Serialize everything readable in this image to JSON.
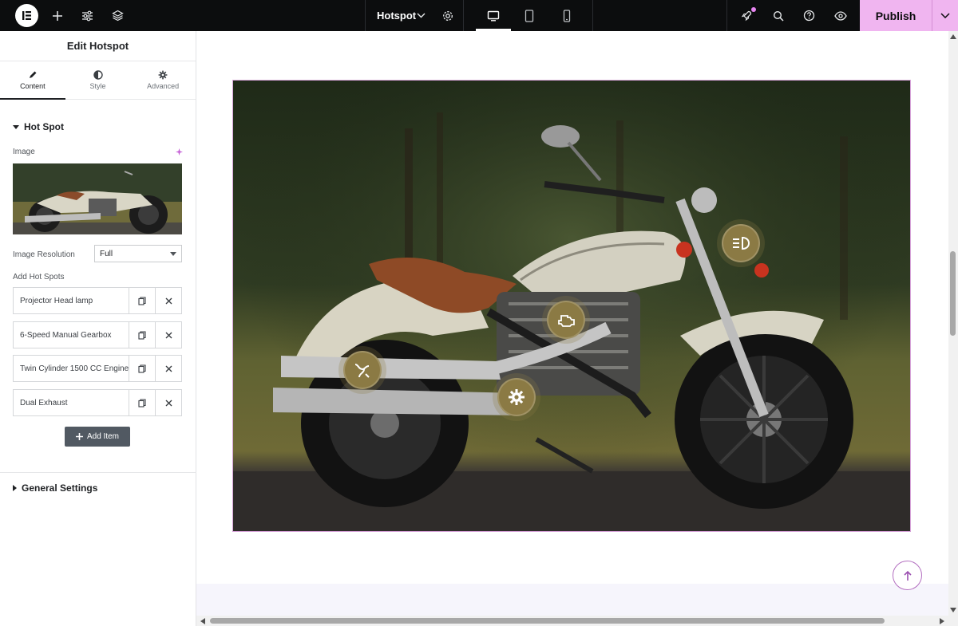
{
  "topbar": {
    "document_title": "Hotspot",
    "publish_label": "Publish",
    "icons": [
      "elementor-logo-icon",
      "plus-icon",
      "sliders-icon",
      "layers-icon",
      "chevron-down-icon",
      "gear-icon",
      "desktop-icon",
      "tablet-icon",
      "mobile-icon",
      "rocket-icon",
      "search-icon",
      "help-icon",
      "eye-icon",
      "chevron-down-icon"
    ]
  },
  "panel": {
    "title": "Edit Hotspot",
    "tabs": [
      {
        "label": "Content",
        "icon": "pencil-icon",
        "active": true
      },
      {
        "label": "Style",
        "icon": "contrast-icon",
        "active": false
      },
      {
        "label": "Advanced",
        "icon": "gear-icon",
        "active": false
      }
    ],
    "hotspot_section": {
      "title": "Hot Spot",
      "image_label": "Image",
      "resolution_label": "Image Resolution",
      "resolution_value": "Full",
      "add_hotspots_label": "Add Hot Spots",
      "items": [
        {
          "label": "Projector Head lamp"
        },
        {
          "label": "6-Speed Manual Gearbox"
        },
        {
          "label": "Twin Cylinder 1500 CC Engine"
        },
        {
          "label": "Dual Exhaust"
        }
      ],
      "add_item_label": "Add Item"
    },
    "general_section": {
      "title": "General Settings"
    }
  },
  "canvas": {
    "hotspots": [
      {
        "name": "headlamp-hotspot",
        "icon": "headlight-icon"
      },
      {
        "name": "engine-hotspot",
        "icon": "engine-icon"
      },
      {
        "name": "exhaust-hotspot",
        "icon": "exhaust-icon"
      },
      {
        "name": "gearbox-hotspot",
        "icon": "gear-icon"
      }
    ]
  },
  "colors": {
    "topbar": "#0c0d0e",
    "publish": "#f0b5f0",
    "hotspot": "#8b7a44",
    "frame_border": "#d6a3d8"
  }
}
